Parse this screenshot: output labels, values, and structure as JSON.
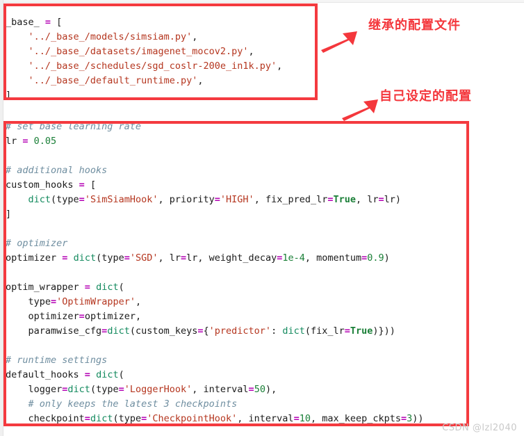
{
  "editor": {
    "language": "python",
    "background": "#ffffff",
    "colors": {
      "operator": "#b400b4",
      "builtin_function": "#138a5e",
      "string": "#b5361f",
      "number": "#1a7f37",
      "boolean": "#1a7f37",
      "comment": "#6f8ea0",
      "text": "#1b1b1b",
      "annotation_red": "#f43a3f"
    }
  },
  "code_block_inherited": {
    "lines": [
      [
        {
          "t": "_base_ ",
          "c": "plain"
        },
        {
          "t": "=",
          "c": "op"
        },
        {
          "t": " [",
          "c": "plain"
        }
      ],
      [
        {
          "t": "    ",
          "c": "plain"
        },
        {
          "t": "'../_base_/models/simsiam.py'",
          "c": "str"
        },
        {
          "t": ",",
          "c": "plain"
        }
      ],
      [
        {
          "t": "    ",
          "c": "plain"
        },
        {
          "t": "'../_base_/datasets/imagenet_mocov2.py'",
          "c": "str"
        },
        {
          "t": ",",
          "c": "plain"
        }
      ],
      [
        {
          "t": "    ",
          "c": "plain"
        },
        {
          "t": "'../_base_/schedules/sgd_coslr-200e_in1k.py'",
          "c": "str"
        },
        {
          "t": ",",
          "c": "plain"
        }
      ],
      [
        {
          "t": "    ",
          "c": "plain"
        },
        {
          "t": "'../_base_/default_runtime.py'",
          "c": "str"
        },
        {
          "t": ",",
          "c": "plain"
        }
      ],
      [
        {
          "t": "]",
          "c": "plain"
        }
      ]
    ]
  },
  "code_block_custom": {
    "lines": [
      [
        {
          "t": "# set base learning rate",
          "c": "cmt"
        }
      ],
      [
        {
          "t": "lr ",
          "c": "plain"
        },
        {
          "t": "=",
          "c": "op"
        },
        {
          "t": " ",
          "c": "plain"
        },
        {
          "t": "0.05",
          "c": "num"
        }
      ],
      [
        {
          "t": "",
          "c": "plain"
        }
      ],
      [
        {
          "t": "# additional hooks",
          "c": "cmt"
        }
      ],
      [
        {
          "t": "custom_hooks ",
          "c": "plain"
        },
        {
          "t": "=",
          "c": "op"
        },
        {
          "t": " [",
          "c": "plain"
        }
      ],
      [
        {
          "t": "    ",
          "c": "plain"
        },
        {
          "t": "dict",
          "c": "fn"
        },
        {
          "t": "(type",
          "c": "plain"
        },
        {
          "t": "=",
          "c": "op"
        },
        {
          "t": "'SimSiamHook'",
          "c": "str"
        },
        {
          "t": ", priority",
          "c": "plain"
        },
        {
          "t": "=",
          "c": "op"
        },
        {
          "t": "'HIGH'",
          "c": "str"
        },
        {
          "t": ", fix_pred_lr",
          "c": "plain"
        },
        {
          "t": "=",
          "c": "op"
        },
        {
          "t": "True",
          "c": "boolv"
        },
        {
          "t": ", lr",
          "c": "plain"
        },
        {
          "t": "=",
          "c": "op"
        },
        {
          "t": "lr)",
          "c": "plain"
        }
      ],
      [
        {
          "t": "]",
          "c": "plain"
        }
      ],
      [
        {
          "t": "",
          "c": "plain"
        }
      ],
      [
        {
          "t": "# optimizer",
          "c": "cmt"
        }
      ],
      [
        {
          "t": "optimizer ",
          "c": "plain"
        },
        {
          "t": "=",
          "c": "op"
        },
        {
          "t": " ",
          "c": "plain"
        },
        {
          "t": "dict",
          "c": "fn"
        },
        {
          "t": "(type",
          "c": "plain"
        },
        {
          "t": "=",
          "c": "op"
        },
        {
          "t": "'SGD'",
          "c": "str"
        },
        {
          "t": ", lr",
          "c": "plain"
        },
        {
          "t": "=",
          "c": "op"
        },
        {
          "t": "lr, weight_decay",
          "c": "plain"
        },
        {
          "t": "=",
          "c": "op"
        },
        {
          "t": "1e-4",
          "c": "num"
        },
        {
          "t": ", momentum",
          "c": "plain"
        },
        {
          "t": "=",
          "c": "op"
        },
        {
          "t": "0.9",
          "c": "num"
        },
        {
          "t": ")",
          "c": "plain"
        }
      ],
      [
        {
          "t": "",
          "c": "plain"
        }
      ],
      [
        {
          "t": "optim_wrapper ",
          "c": "plain"
        },
        {
          "t": "=",
          "c": "op"
        },
        {
          "t": " ",
          "c": "plain"
        },
        {
          "t": "dict",
          "c": "fn"
        },
        {
          "t": "(",
          "c": "plain"
        }
      ],
      [
        {
          "t": "    type",
          "c": "plain"
        },
        {
          "t": "=",
          "c": "op"
        },
        {
          "t": "'OptimWrapper'",
          "c": "str"
        },
        {
          "t": ",",
          "c": "plain"
        }
      ],
      [
        {
          "t": "    optimizer",
          "c": "plain"
        },
        {
          "t": "=",
          "c": "op"
        },
        {
          "t": "optimizer,",
          "c": "plain"
        }
      ],
      [
        {
          "t": "    paramwise_cfg",
          "c": "plain"
        },
        {
          "t": "=",
          "c": "op"
        },
        {
          "t": "dict",
          "c": "fn"
        },
        {
          "t": "(custom_keys",
          "c": "plain"
        },
        {
          "t": "=",
          "c": "op"
        },
        {
          "t": "{",
          "c": "plain"
        },
        {
          "t": "'predictor'",
          "c": "str"
        },
        {
          "t": ": ",
          "c": "plain"
        },
        {
          "t": "dict",
          "c": "fn"
        },
        {
          "t": "(fix_lr",
          "c": "plain"
        },
        {
          "t": "=",
          "c": "op"
        },
        {
          "t": "True",
          "c": "boolv"
        },
        {
          "t": ")}))",
          "c": "plain"
        }
      ],
      [
        {
          "t": "",
          "c": "plain"
        }
      ],
      [
        {
          "t": "# runtime settings",
          "c": "cmt"
        }
      ],
      [
        {
          "t": "default_hooks ",
          "c": "plain"
        },
        {
          "t": "=",
          "c": "op"
        },
        {
          "t": " ",
          "c": "plain"
        },
        {
          "t": "dict",
          "c": "fn"
        },
        {
          "t": "(",
          "c": "plain"
        }
      ],
      [
        {
          "t": "    logger",
          "c": "plain"
        },
        {
          "t": "=",
          "c": "op"
        },
        {
          "t": "dict",
          "c": "fn"
        },
        {
          "t": "(type",
          "c": "plain"
        },
        {
          "t": "=",
          "c": "op"
        },
        {
          "t": "'LoggerHook'",
          "c": "str"
        },
        {
          "t": ", interval",
          "c": "plain"
        },
        {
          "t": "=",
          "c": "op"
        },
        {
          "t": "50",
          "c": "num"
        },
        {
          "t": "),",
          "c": "plain"
        }
      ],
      [
        {
          "t": "    # only keeps the latest 3 checkpoints",
          "c": "cmt"
        }
      ],
      [
        {
          "t": "    checkpoint",
          "c": "plain"
        },
        {
          "t": "=",
          "c": "op"
        },
        {
          "t": "dict",
          "c": "fn"
        },
        {
          "t": "(type",
          "c": "plain"
        },
        {
          "t": "=",
          "c": "op"
        },
        {
          "t": "'CheckpointHook'",
          "c": "str"
        },
        {
          "t": ", interval",
          "c": "plain"
        },
        {
          "t": "=",
          "c": "op"
        },
        {
          "t": "10",
          "c": "num"
        },
        {
          "t": ", max_keep_ckpts",
          "c": "plain"
        },
        {
          "t": "=",
          "c": "op"
        },
        {
          "t": "3",
          "c": "num"
        },
        {
          "t": "))",
          "c": "plain"
        }
      ]
    ]
  },
  "annotations": {
    "inherited": {
      "label": "继承的配置文件",
      "arrow": "arrow-up-right"
    },
    "custom": {
      "label": "自己设定的配置",
      "arrow": "arrow-up-right"
    }
  },
  "watermark": {
    "text": "CSDN @lzl2040"
  }
}
